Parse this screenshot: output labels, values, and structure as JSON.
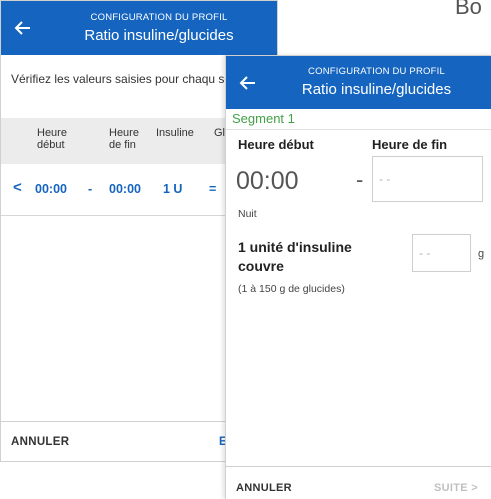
{
  "corner_text": "Bo",
  "back_screen": {
    "header": {
      "supertitle": "CONFIGURATION DU PROFIL",
      "title": "Ratio insuline/glucides"
    },
    "instruction": "Vérifiez les valeurs saisies pour chaqu segment.",
    "table": {
      "columns": [
        {
          "line1": "Heure",
          "line2": "début"
        },
        {
          "line1": "Heure",
          "line2": "de fin"
        },
        {
          "line1": "Insuline",
          "line2": ""
        },
        {
          "line1": "Gl",
          "line2": ""
        }
      ],
      "row": {
        "chevron": "<",
        "start": "00:00",
        "dash": "-",
        "end": "00:00",
        "insulin": "1 U",
        "equals": "="
      }
    },
    "footer": {
      "cancel": "ANNULER",
      "edit": "E"
    }
  },
  "front_screen": {
    "header": {
      "supertitle": "CONFIGURATION DU PROFIL",
      "title": "Ratio insuline/glucides"
    },
    "segment_label": "Segment 1",
    "start_label": "Heure début",
    "end_label": "Heure de fin",
    "start_time": "00:00",
    "time_dash": "-",
    "end_placeholder": "- -",
    "period": "Nuit",
    "units_label": "1 unité d'insuline couvre",
    "carb_placeholder": "- -",
    "carb_unit": "g",
    "range_hint": "(1 à 150 g de glucides)",
    "footer": {
      "cancel": "ANNULER",
      "next": "SUITE >"
    }
  },
  "colors": {
    "header_blue": "#1565c0",
    "segment_green": "#43a047",
    "disabled_gray": "#c0c0c0"
  }
}
